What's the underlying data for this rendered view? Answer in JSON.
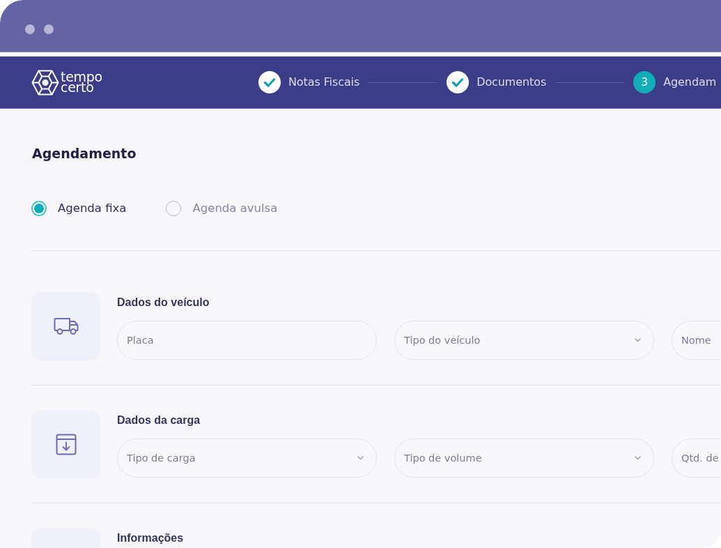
{
  "header": {
    "logo": {
      "lines": [
        "tempo",
        "certo"
      ]
    },
    "steps": [
      {
        "label": "Notas Fiscais",
        "completed": true
      },
      {
        "label": "Documentos",
        "completed": true
      },
      {
        "number": "3",
        "label": "Agendam",
        "completed": false
      }
    ]
  },
  "page": {
    "title": "Agendamento",
    "schedule_type": [
      {
        "label": "Agenda fixa",
        "selected": true
      },
      {
        "label": "Agenda avulsa",
        "selected": false
      }
    ],
    "sections": [
      {
        "title": "Dados do veículo",
        "fields": [
          {
            "kind": "text",
            "placeholder": "Placa"
          },
          {
            "kind": "select",
            "placeholder": "Tipo do veículo"
          },
          {
            "kind": "text",
            "placeholder": "Nome"
          }
        ]
      },
      {
        "title": "Dados da carga",
        "fields": [
          {
            "kind": "select",
            "placeholder": "Tipo de carga"
          },
          {
            "kind": "select",
            "placeholder": "Tipo de volume"
          },
          {
            "kind": "text",
            "placeholder": "Qtd. de"
          }
        ]
      },
      {
        "title": "Informações"
      }
    ]
  }
}
